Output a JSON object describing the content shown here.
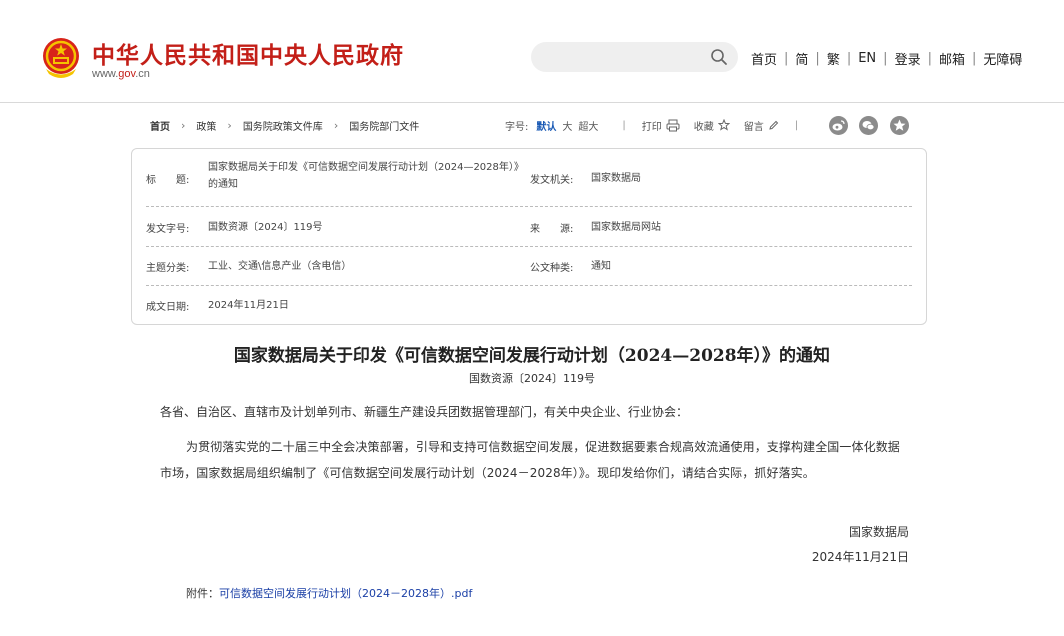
{
  "header": {
    "site_title": "中华人民共和国中央人民政府",
    "domain_prefix": "www.",
    "domain_main": "gov",
    "domain_suffix": ".cn",
    "search_placeholder": "",
    "nav": [
      "首页",
      "简",
      "繁",
      "EN",
      "登录",
      "邮箱",
      "无障碍"
    ]
  },
  "breadcrumb": [
    "首页",
    "政策",
    "国务院政策文件库",
    "国务院部门文件"
  ],
  "toolbar": {
    "font_size_label": "字号:",
    "font_sizes": [
      "默认",
      "大",
      "超大"
    ],
    "print": "打印",
    "favorite": "收藏",
    "comment": "留言"
  },
  "meta": {
    "title_label": "标　　题:",
    "title_value": "国家数据局关于印发《可信数据空间发展行动计划（2024—2028年）》的通知",
    "issuer_label": "发文机关:",
    "issuer_value": "国家数据局",
    "docno_label": "发文字号:",
    "docno_value": "国数资源〔2024〕119号",
    "source_label": "来　　源:",
    "source_value": "国家数据局网站",
    "topic_label": "主题分类:",
    "topic_value": "工业、交通\\信息产业（含电信）",
    "type_label": "公文种类:",
    "type_value": "通知",
    "date_label": "成文日期:",
    "date_value": "2024年11月21日"
  },
  "article": {
    "title": "国家数据局关于印发《可信数据空间发展行动计划（2024—2028年）》的通知",
    "docno": "国数资源〔2024〕119号",
    "salutation": "各省、自治区、直辖市及计划单列市、新疆生产建设兵团数据管理部门，有关中央企业、行业协会：",
    "body": "为贯彻落实党的二十届三中全会决策部署，引导和支持可信数据空间发展，促进数据要素合规高效流通使用，支撑构建全国一体化数据市场，国家数据局组织编制了《可信数据空间发展行动计划（2024－2028年）》。现印发给你们，请结合实际，抓好落实。",
    "signature": "国家数据局",
    "sign_date": "2024年11月21日",
    "attachment_label": "附件：",
    "attachment_link": "可信数据空间发展行动计划（2024－2028年）.pdf"
  },
  "colors": {
    "brand_red": "#c31f18",
    "link_blue": "#1a3fa6"
  }
}
